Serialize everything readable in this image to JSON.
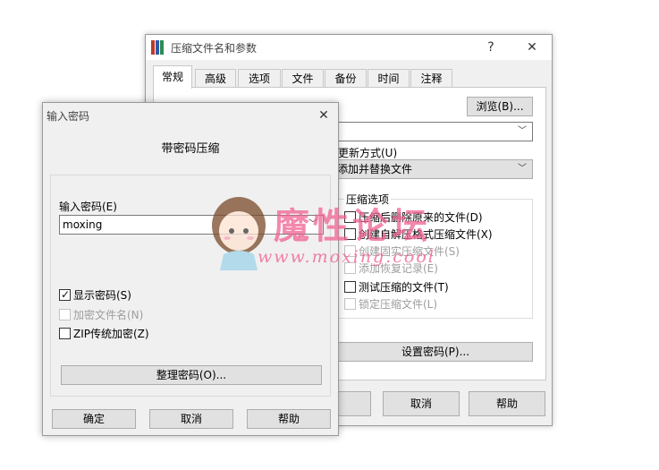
{
  "back_dialog": {
    "title": "压缩文件名和参数",
    "help_glyph": "?",
    "close_glyph": "✕",
    "tabs": [
      {
        "label": "常规",
        "active": true
      },
      {
        "label": "高级"
      },
      {
        "label": "选项"
      },
      {
        "label": "文件"
      },
      {
        "label": "备份"
      },
      {
        "label": "时间"
      },
      {
        "label": "注释"
      }
    ],
    "browse_label": "浏览(B)...",
    "update_mode_label": "更新方式(U)",
    "update_mode_value": "添加并替换文件",
    "options_group_title": "压缩选项",
    "options": [
      {
        "label": "压缩后删除原来的文件(D)",
        "checked": false,
        "disabled": false
      },
      {
        "label": "创建自解压格式压缩文件(X)",
        "checked": false,
        "disabled": false
      },
      {
        "label": "创建固实压缩文件(S)",
        "checked": false,
        "disabled": true
      },
      {
        "label": "添加恢复记录(E)",
        "checked": false,
        "disabled": true
      },
      {
        "label": "测试压缩的文件(T)",
        "checked": false,
        "disabled": false
      },
      {
        "label": "锁定压缩文件(L)",
        "checked": false,
        "disabled": true
      }
    ],
    "set_password_label": "设置密码(P)...",
    "ok_partial": "定",
    "cancel_label": "取消",
    "help_label": "帮助"
  },
  "front_dialog": {
    "title": "输入密码",
    "close_glyph": "✕",
    "heading": "带密码压缩",
    "password_label": "输入密码(E)",
    "password_value": "moxing",
    "show_password": {
      "label": "显示密码(S)",
      "checked": true,
      "disabled": false
    },
    "encrypt_names": {
      "label": "加密文件名(N)",
      "checked": false,
      "disabled": true
    },
    "zip_legacy": {
      "label": "ZIP传统加密(Z)",
      "checked": false,
      "disabled": false
    },
    "organize_label": "整理密码(O)...",
    "ok_label": "确定",
    "cancel_label": "取消",
    "help_label": "帮助"
  },
  "watermark": {
    "main": "魔性论坛",
    "url": "www.moxing.cool"
  },
  "colors": {
    "watermark_pink": "#f06292",
    "icon_red": "#c0392b",
    "icon_blue": "#2e5aa8",
    "icon_green": "#2e8b57"
  }
}
